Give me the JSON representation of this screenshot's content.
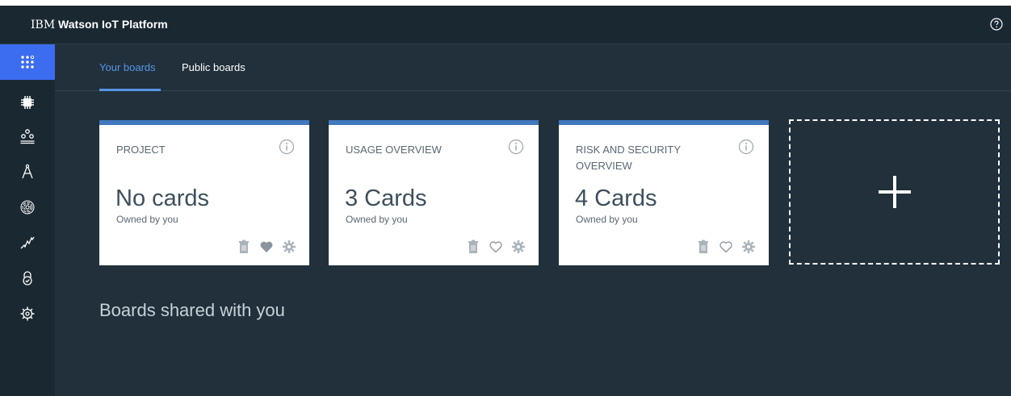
{
  "app": {
    "brand_prefix": "IBM",
    "brand_name": "Watson IoT Platform",
    "help_icon": "help-circle-icon"
  },
  "sidebar": {
    "items": [
      {
        "icon": "apps-grid-icon",
        "active": true
      },
      {
        "icon": "chip-icon",
        "active": false
      },
      {
        "icon": "members-icon",
        "active": false
      },
      {
        "icon": "compass-icon",
        "active": false
      },
      {
        "icon": "fingerprint-icon",
        "active": false
      },
      {
        "icon": "analytics-icon",
        "active": false
      },
      {
        "icon": "security-lock-icon",
        "active": false
      },
      {
        "icon": "settings-icon",
        "active": false
      }
    ]
  },
  "tabs": [
    {
      "label": "Your boards",
      "active": true
    },
    {
      "label": "Public boards",
      "active": false
    }
  ],
  "boards": [
    {
      "title": "PROJECT",
      "count": "No cards",
      "owner": "Owned by you",
      "favorite": true
    },
    {
      "title": "USAGE OVERVIEW",
      "count": "3 Cards",
      "owner": "Owned by you",
      "favorite": false
    },
    {
      "title": "RISK AND SECURITY OVERVIEW",
      "count": "4 Cards",
      "owner": "Owned by you",
      "favorite": false
    }
  ],
  "add_board_icon": "plus-icon",
  "shared_section": {
    "title": "Boards shared with you"
  },
  "colors": {
    "accent": "#3c6df0",
    "active_tab": "#5596e6",
    "card_top_border": "#4178be",
    "background": "#21303b"
  }
}
